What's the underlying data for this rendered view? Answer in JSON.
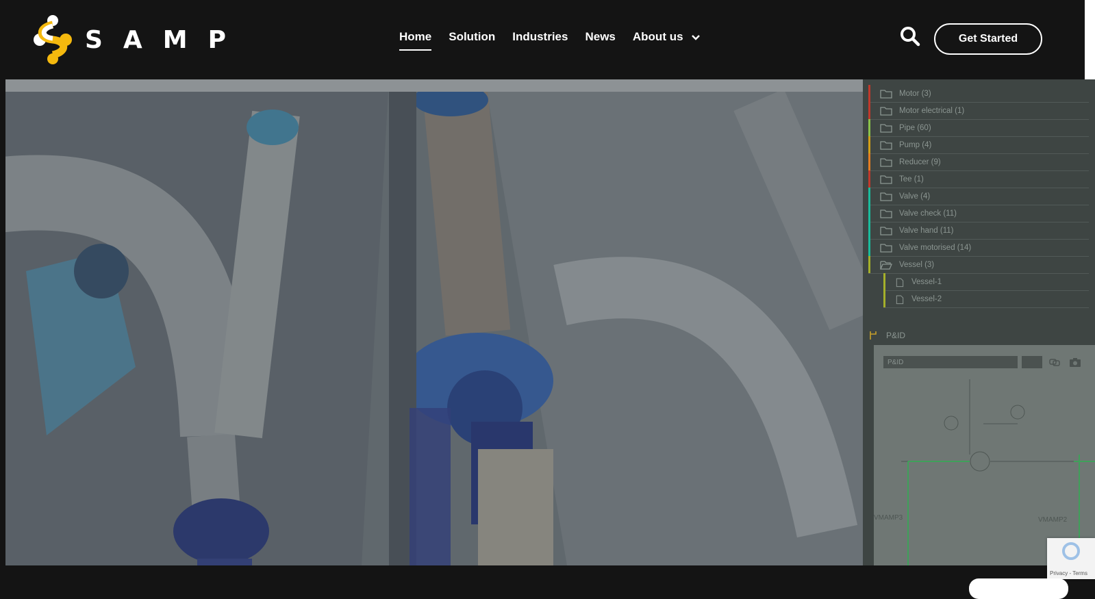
{
  "brand": {
    "name": "SAMP"
  },
  "nav": {
    "items": [
      {
        "label": "Home",
        "active": true
      },
      {
        "label": "Solution",
        "active": false
      },
      {
        "label": "Industries",
        "active": false
      },
      {
        "label": "News",
        "active": false
      },
      {
        "label": "About us",
        "active": false,
        "has_dropdown": true
      }
    ]
  },
  "header": {
    "cta_label": "Get Started",
    "search_icon": "search-icon"
  },
  "panel": {
    "tree": [
      {
        "label": "Motor (3)",
        "color": "#c0392b"
      },
      {
        "label": "Motor electrical (1)",
        "color": "#c0392b"
      },
      {
        "label": "Pipe (60)",
        "color": "#8bc34a"
      },
      {
        "label": "Pump (4)",
        "color": "#d4a017"
      },
      {
        "label": "Reducer (9)",
        "color": "#e67e22"
      },
      {
        "label": "Tee (1)",
        "color": "#c0392b"
      },
      {
        "label": "Valve (4)",
        "color": "#1abc9c"
      },
      {
        "label": "Valve check (11)",
        "color": "#1abc9c"
      },
      {
        "label": "Valve hand (11)",
        "color": "#1abc9c"
      },
      {
        "label": "Valve motorised (14)",
        "color": "#1abc9c"
      },
      {
        "label": "Vessel (3)",
        "color": "#a5b02a"
      }
    ],
    "children": [
      {
        "label": "Vessel-1"
      },
      {
        "label": "Vessel-2"
      }
    ],
    "pid_title": "P&ID",
    "pid_select": "P&ID",
    "pid_labels": [
      "VMAMP3",
      "VMAMP2"
    ]
  },
  "recaptcha": {
    "text": "Privacy - Terms"
  }
}
